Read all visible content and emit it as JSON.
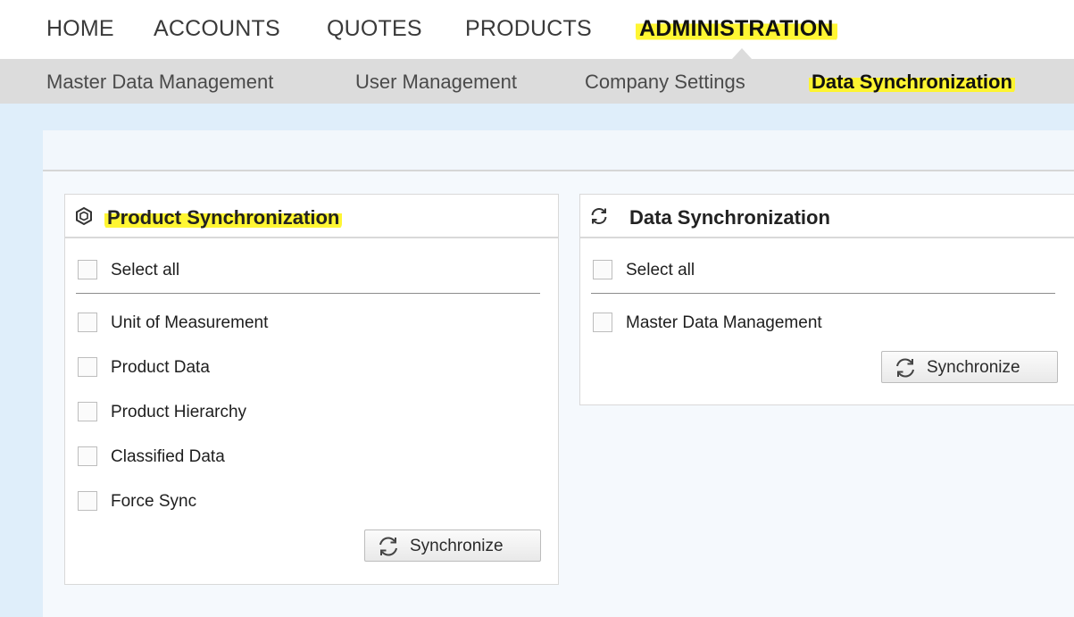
{
  "topnav": {
    "items": [
      "HOME",
      "ACCOUNTS",
      "QUOTES",
      "PRODUCTS",
      "ADMINISTRATION"
    ],
    "active": "ADMINISTRATION"
  },
  "subnav": {
    "items": [
      "Master Data Management",
      "User Management",
      "Company Settings",
      "Data Synchronization"
    ],
    "active": "Data Synchronization"
  },
  "product_panel": {
    "title": "Product Synchronization",
    "icon": "cube-icon",
    "select_all": "Select all",
    "options": [
      "Unit of Measurement",
      "Product Data",
      "Product Hierarchy",
      "Classified Data",
      "Force Sync"
    ],
    "button": "Synchronize"
  },
  "data_panel": {
    "title": "Data Synchronization",
    "icon": "sync-icon",
    "select_all": "Select all",
    "options": [
      "Master Data Management"
    ],
    "button": "Synchronize"
  },
  "colors": {
    "highlight": "#fff528",
    "subnav_bg": "#dcdcdc",
    "content_bg": "#dfeefa"
  }
}
